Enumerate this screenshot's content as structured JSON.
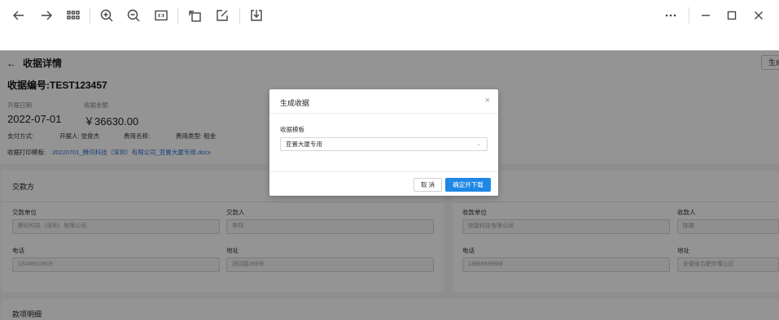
{
  "toolbar": {
    "icons": [
      "back-arrow-icon",
      "forward-arrow-icon",
      "grid-view-icon",
      "zoom-in-icon",
      "zoom-out-icon",
      "actual-size-icon",
      "rotate-icon",
      "edit-icon",
      "download-icon",
      "more-icon",
      "minimize-icon",
      "maximize-icon",
      "close-icon"
    ]
  },
  "page": {
    "back_label": "收据详情",
    "generate_btn": "生成",
    "receipt_no": "收据编号:TEST123457",
    "issue_date_label": "开据日期",
    "issue_date": "2022-07-01",
    "amount_label": "收据金额",
    "amount": "￥36630.00",
    "payment_method": "支付方式:",
    "drawer": "开据人: 张俊杰",
    "fee_name": "费用名称:",
    "fee_type": "费用类型: 租金",
    "template_label": "收据打印模板:",
    "template_link": "20220701_腾讯科技（深圳）有限公司_亚置大厦专用.docx"
  },
  "payer_card": {
    "title": "交款方",
    "unit_label": "交款单位",
    "unit_value": "腾讯科技（深圳）有限公司",
    "person_label": "交款人",
    "person_value": "李四",
    "phone_label": "电话",
    "phone_value": "13348010809",
    "address_label": "地址",
    "address_value": "测试路369号"
  },
  "payee_card": {
    "unit_label": "收款单位",
    "unit_value": "快捷科技有限公司",
    "person_label": "收款人",
    "person_value": "陈楼",
    "phone_label": "电话",
    "phone_value": "13888888888",
    "address_label": "地址",
    "address_value": "安徽省合肥市蜀山区"
  },
  "items_card": {
    "title": "款项明细"
  },
  "modal": {
    "title": "生成收据",
    "close": "×",
    "field_label": "收据模板",
    "field_value": "亚置大厦专用",
    "cancel": "取 消",
    "confirm": "确定并下载"
  }
}
